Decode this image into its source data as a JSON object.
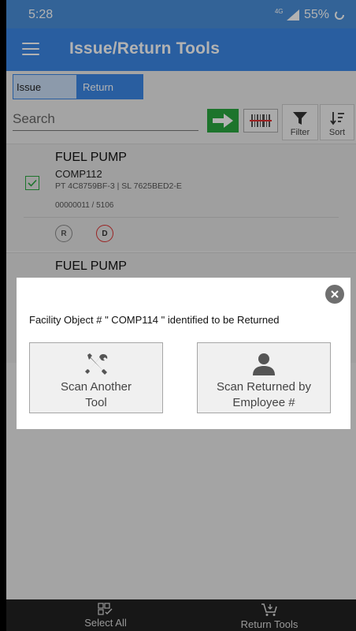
{
  "status_bar": {
    "time": "5:28",
    "network": "4G",
    "battery": "55%"
  },
  "app_bar": {
    "title": "Issue/Return Tools"
  },
  "tabs": {
    "issue": "Issue",
    "return": "Return",
    "selected": "Return"
  },
  "search": {
    "placeholder": "Search"
  },
  "toolbar": {
    "filter_label": "Filter",
    "sort_label": "Sort"
  },
  "items": [
    {
      "name": "FUEL PUMP",
      "code": "COMP112",
      "part_serial": "PT 4C8759BF-3 | SL 7625BED2-E",
      "quantity": "00000011 / 5106",
      "checked": true,
      "badges": [
        "R",
        "D"
      ]
    },
    {
      "name": "FUEL PUMP"
    }
  ],
  "dialog": {
    "message": "Facility Object # \" COMP114 \" identified to be Returned",
    "left_button": {
      "line1": "Scan Another",
      "line2": "Tool"
    },
    "right_button": {
      "line1": "Scan Returned by",
      "line2": "Employee #"
    }
  },
  "bottom_bar": {
    "select_all": "Select All",
    "return_tools": "Return Tools"
  },
  "colors": {
    "app_bar": "#3b87e6",
    "status_bar": "#4a8fd8",
    "go_button": "#2aa640",
    "badge_d": "#dd3333"
  }
}
